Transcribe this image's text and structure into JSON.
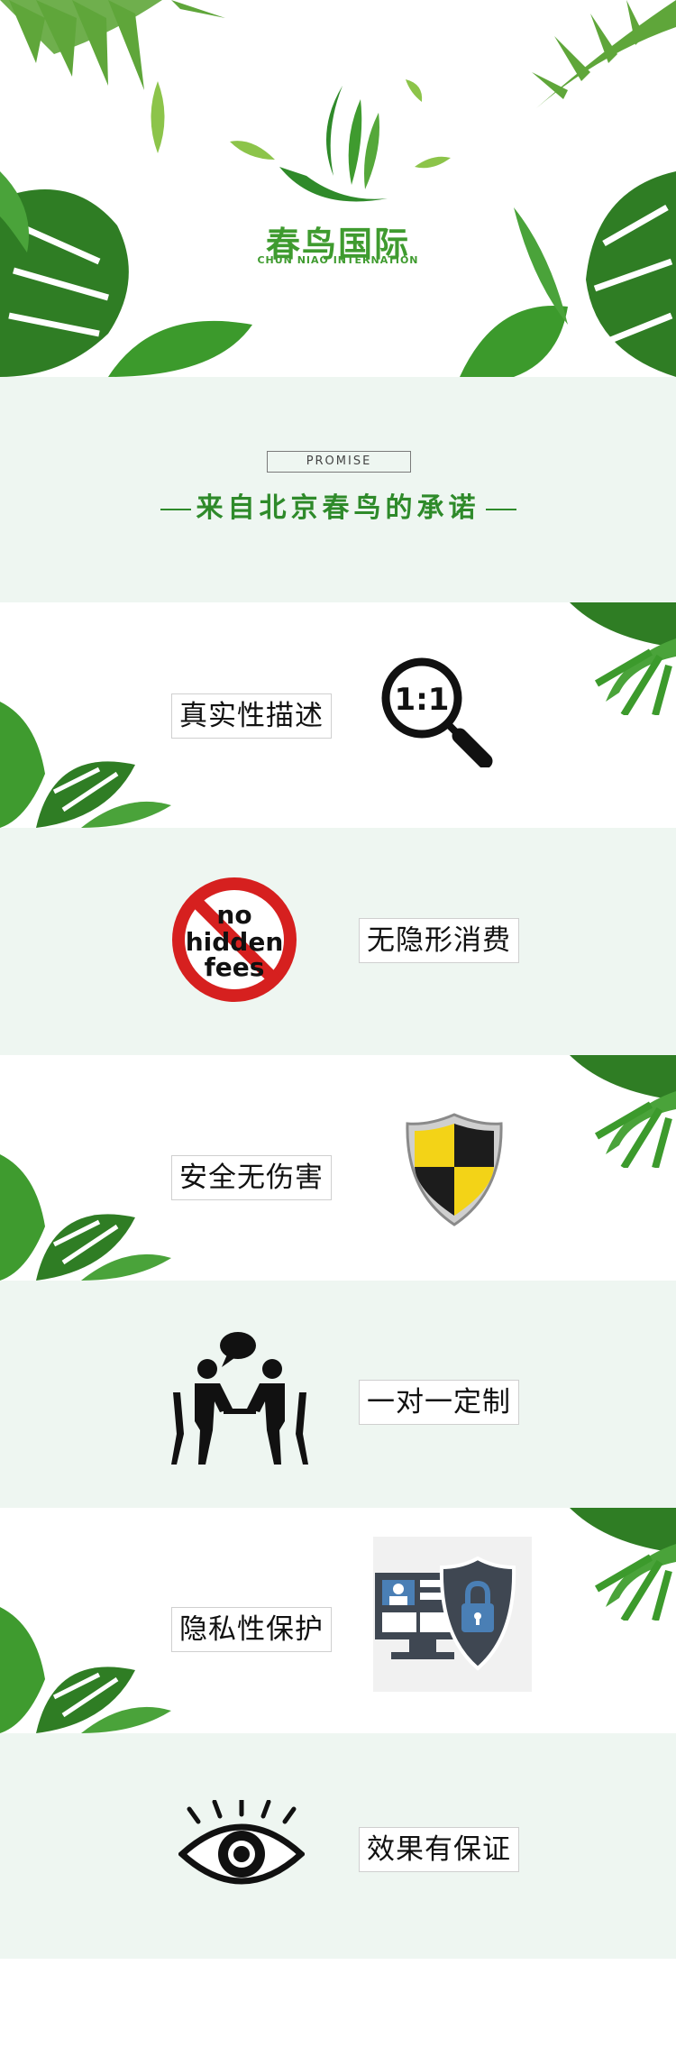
{
  "header": {
    "brand_cn": "春鸟国际",
    "brand_en": "CHUN NIAO INTERNATION"
  },
  "promise": {
    "tag": "PROMISE",
    "title": "来自北京春鸟的承诺"
  },
  "features": [
    {
      "label": "真实性描述",
      "icon": "magnifier-1-to-1-icon"
    },
    {
      "label": "无隐形消费",
      "icon": "no-hidden-fees-icon",
      "badge_lines": [
        "no",
        "hidden",
        "fees"
      ]
    },
    {
      "label": "安全无伤害",
      "icon": "shield-icon"
    },
    {
      "label": "一对一定制",
      "icon": "consultation-icon"
    },
    {
      "label": "隐私性保护",
      "icon": "privacy-lock-icon"
    },
    {
      "label": "效果有保证",
      "icon": "eye-icon"
    }
  ],
  "magnifier_text": "1:1",
  "colors": {
    "accent_green": "#2e8a2a",
    "mint_bg": "#eef6f1",
    "no_fees_red": "#d6201f",
    "shield_yellow": "#f3d317"
  }
}
